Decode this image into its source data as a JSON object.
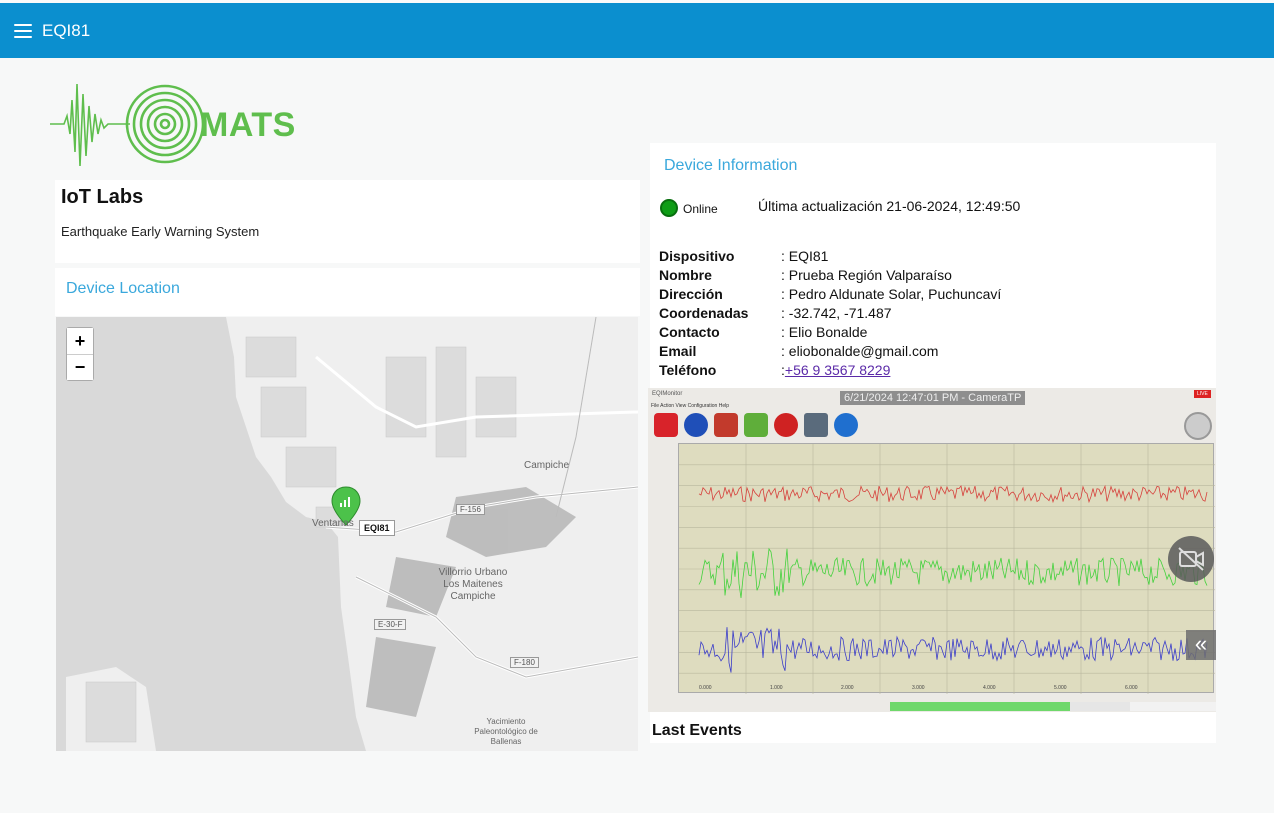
{
  "appbar": {
    "title": "EQI81",
    "menu_icon": "hamburger-menu-icon"
  },
  "logo": {
    "text": "MATS",
    "color": "#5fbe4d"
  },
  "org": {
    "title": "IoT Labs",
    "subtitle": "Earthquake Early Warning System"
  },
  "location": {
    "title": "Device Location",
    "zoom_in": "+",
    "zoom_out": "−",
    "marker_label": "EQI81",
    "marker_color": "#4cc24a",
    "place_labels": [
      "Campiche",
      "Ventanas",
      "Villorrio Urbano Los Maitenes Campiche",
      "Yacimiento Paleontológico de Ballenas"
    ],
    "road_labels": [
      "F-156",
      "E-30-F",
      "F-180"
    ]
  },
  "device": {
    "title": "Device Information",
    "status": "Online",
    "status_color": "#0e9d16",
    "last_update": "Última actualización 21-06-2024, 12:49:50",
    "fields": [
      {
        "label": "Dispositivo",
        "value": ": EQI81"
      },
      {
        "label": "Nombre",
        "value": ": Prueba Región Valparaíso"
      },
      {
        "label": "Dirección",
        "value": ": Pedro Aldunate Solar, Puchuncaví"
      },
      {
        "label": "Coordenadas",
        "value": ": -32.742, -71.487"
      },
      {
        "label": "Contacto",
        "value": ": Elio Bonalde"
      },
      {
        "label": "Email",
        "value": ": eliobonalde@gmail.com"
      }
    ],
    "phone_label": "Teléfono",
    "phone_prefix": ": ",
    "phone": "+56 9 3567 8229"
  },
  "camera": {
    "timestamp": "6/21/2024 12:47:01 PM - CameraTP",
    "window_title": "EQIMonitor",
    "menu": "File   Action   View   Configuration   Help",
    "live_badge": "LIVE",
    "axis_ticks": [
      "0.000",
      "1.000",
      "2.000",
      "3.000",
      "4.000",
      "5.000",
      "6.000"
    ],
    "series_colors": [
      "#d6413c",
      "#44d13d",
      "#3c3ec9"
    ]
  },
  "events": {
    "title": "Last Events"
  }
}
